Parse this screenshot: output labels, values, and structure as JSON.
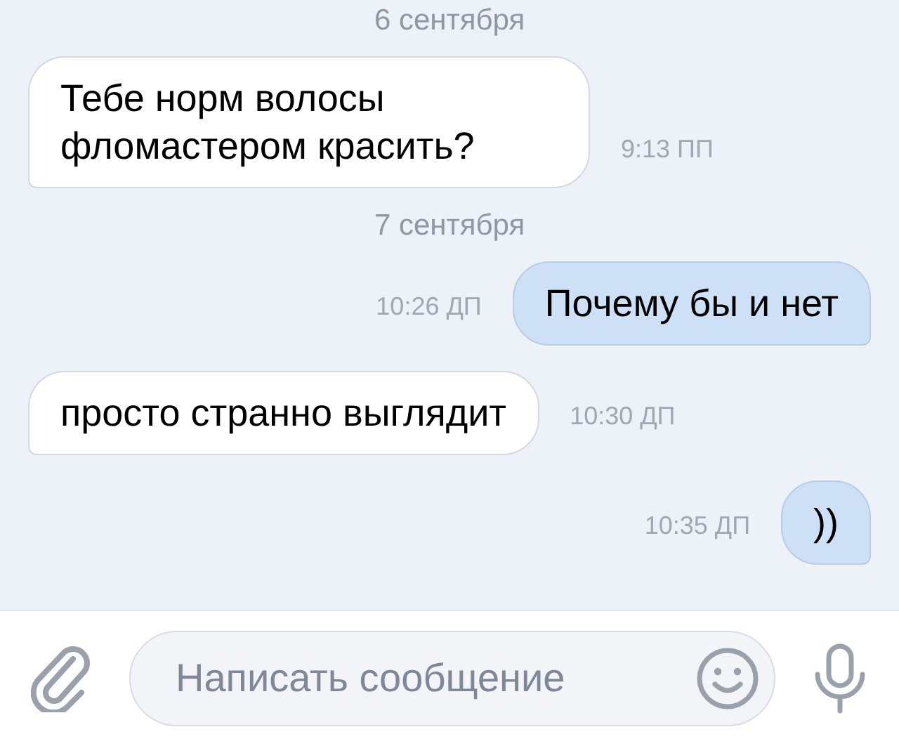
{
  "messages": [
    {
      "kind": "date",
      "text": "6 сентября"
    },
    {
      "kind": "in",
      "text": "Тебе норм волосы фломастером красить?",
      "time": "9:13 ПП"
    },
    {
      "kind": "date",
      "text": "7 сентября"
    },
    {
      "kind": "out",
      "text": "Почему бы и нет",
      "time": "10:26 ДП"
    },
    {
      "kind": "in",
      "text": "просто странно выглядит",
      "time": "10:30 ДП"
    },
    {
      "kind": "out",
      "text": "))",
      "time": "10:35 ДП"
    }
  ],
  "composer": {
    "placeholder": "Написать сообщение"
  }
}
